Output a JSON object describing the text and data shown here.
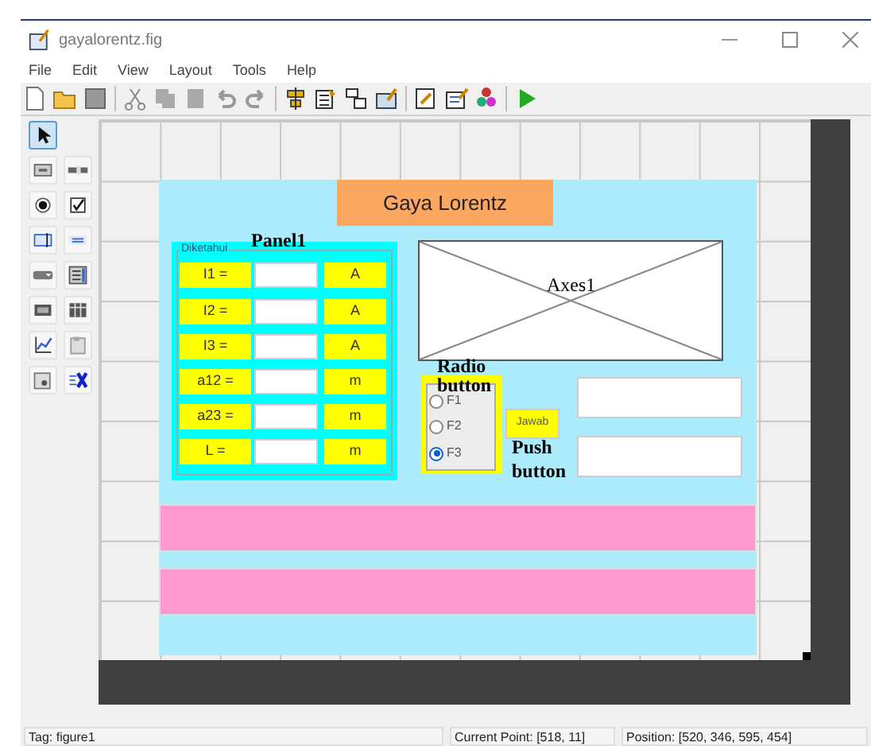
{
  "window": {
    "title": "gayalorentz.fig"
  },
  "menu": [
    "File",
    "Edit",
    "View",
    "Layout",
    "Tools",
    "Help"
  ],
  "palette": [
    {
      "selected": true
    },
    {
      "selected": false
    },
    {
      "selected": false
    },
    {
      "selected": false
    },
    {
      "selected": false
    },
    {
      "selected": false
    },
    {
      "selected": false
    },
    {
      "selected": false
    },
    {
      "selected": false
    },
    {
      "selected": false
    },
    {
      "selected": false
    },
    {
      "selected": false
    },
    {
      "selected": false
    },
    {
      "selected": false
    },
    {
      "selected": false
    }
  ],
  "figure": {
    "title": "Gaya Lorentz",
    "panel": {
      "label": "Diketahui",
      "annotation": "Panel1",
      "rows": [
        {
          "label": "I1 =",
          "unit": "A"
        },
        {
          "label": "I2 =",
          "unit": "A"
        },
        {
          "label": "I3 =",
          "unit": "A"
        },
        {
          "label": "a12 =",
          "unit": "m"
        },
        {
          "label": "a23 =",
          "unit": "m"
        },
        {
          "label": "L =",
          "unit": "m"
        }
      ]
    },
    "axes": {
      "annotation": "Axes1"
    },
    "radio_group": {
      "annotation": "Radio button",
      "options": [
        {
          "label": "F1",
          "selected": false
        },
        {
          "label": "F2",
          "selected": false
        },
        {
          "label": "F3",
          "selected": true
        }
      ]
    },
    "push_button": {
      "label": "Jawab",
      "annotation": "Push button"
    }
  },
  "status_bar": [
    "Tag: figure1",
    "Current Point:  [518, 11]",
    "Position: [520, 346, 595, 454]"
  ]
}
